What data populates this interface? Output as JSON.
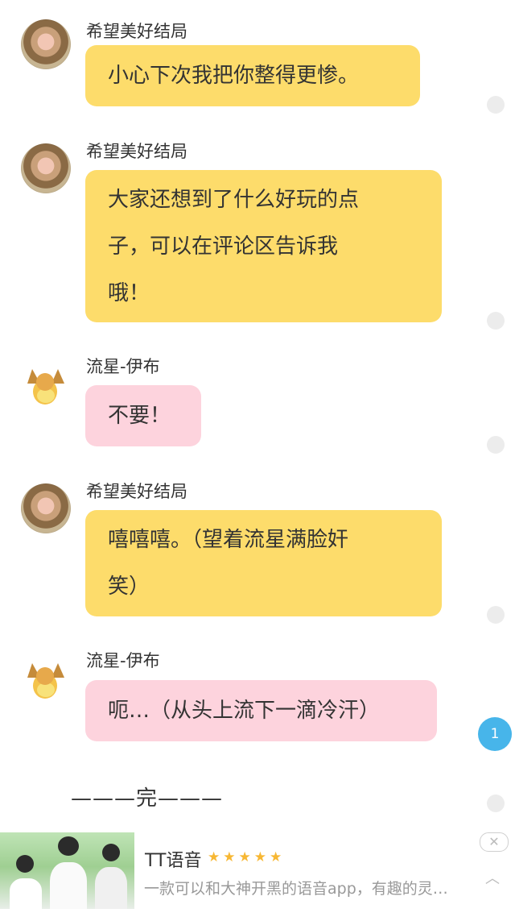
{
  "messages": [
    {
      "user": "希望美好结局",
      "text_lines": [
        "小心下次我把你整得更惨。"
      ],
      "bubble_color": "#fddc6b"
    },
    {
      "user": "希望美好结局",
      "text_lines": [
        "大家还想到了什么好玩的点",
        "子，可以在评论区告诉我",
        "哦！"
      ],
      "bubble_color": "#fddc6b"
    },
    {
      "user": "流星-伊布",
      "text_lines": [
        "不要！"
      ],
      "bubble_color": "#fdd3dd"
    },
    {
      "user": "希望美好结局",
      "text_lines": [
        "嘻嘻嘻。（望着流星满脸奸",
        "笑）"
      ],
      "bubble_color": "#fddc6b"
    },
    {
      "user": "流星-伊布",
      "text_lines": [
        "呃…（从头上流下一滴冷汗）"
      ],
      "bubble_color": "#fdd3dd"
    }
  ],
  "end_marker": "———完———",
  "comment_badge": "1",
  "ad": {
    "title": "TT语音",
    "rating_stars": "★★★★★",
    "description": "一款可以和大神开黑的语音app，有趣的灵…",
    "close_symbol": "✕",
    "collapse_symbol": "︿"
  },
  "icons": {
    "comment_dot": "#ececec",
    "badge_color": "#47b5ea"
  }
}
